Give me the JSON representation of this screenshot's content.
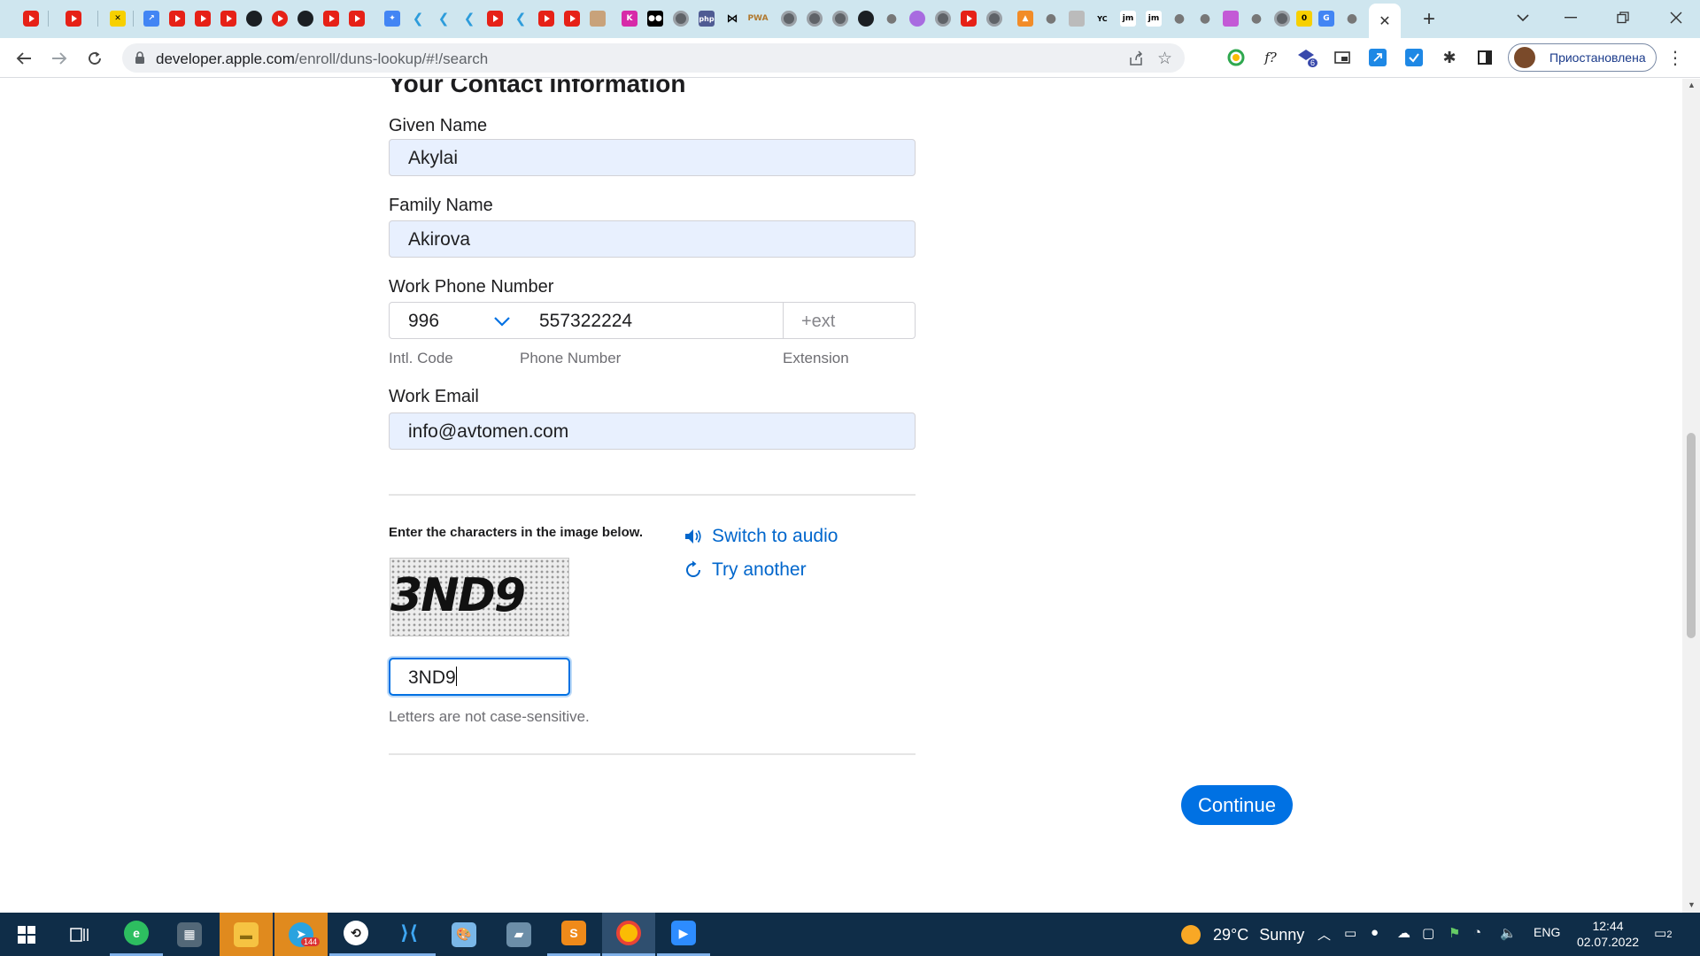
{
  "browser": {
    "active_tab_close": "✕",
    "new_tab": "+",
    "url_host": "developer.apple.com",
    "url_path": "/enroll/duns-lookup/#!/search",
    "profile_label": "Приостановлена",
    "ext_f_label": "f?",
    "ext_badge": "6"
  },
  "page": {
    "section_title": "Your Contact Information",
    "given_name_label": "Given Name",
    "given_name_value": "Akylai",
    "family_name_label": "Family Name",
    "family_name_value": "Akirova",
    "phone_label": "Work Phone Number",
    "intl_code_value": "996",
    "phone_number_value": "557322224",
    "ext_placeholder": "+ext",
    "intl_code_caption": "Intl. Code",
    "phone_number_caption": "Phone Number",
    "extension_caption": "Extension",
    "email_label": "Work Email",
    "email_value": "info@avtomen.com",
    "captcha_prompt": "Enter the characters in the image below.",
    "captcha_image_text": "3ND9",
    "switch_audio": "Switch to audio",
    "try_another": "Try another",
    "captcha_input_value": "3ND9",
    "case_note": "Letters are not case-sensitive.",
    "continue_label": "Continue"
  },
  "taskbar": {
    "weather_temp": "29°C",
    "weather_text": "Sunny",
    "lang": "ENG",
    "time": "12:44",
    "date": "02.07.2022",
    "notifications": "2",
    "telegram_badge": "144"
  },
  "colors": {
    "accent": "#0071e3",
    "link": "#0066cc",
    "autofill_bg": "#e8f0fe",
    "tabstrip_bg": "#cfe6ef",
    "taskbar_bg": "#0f2d48"
  }
}
